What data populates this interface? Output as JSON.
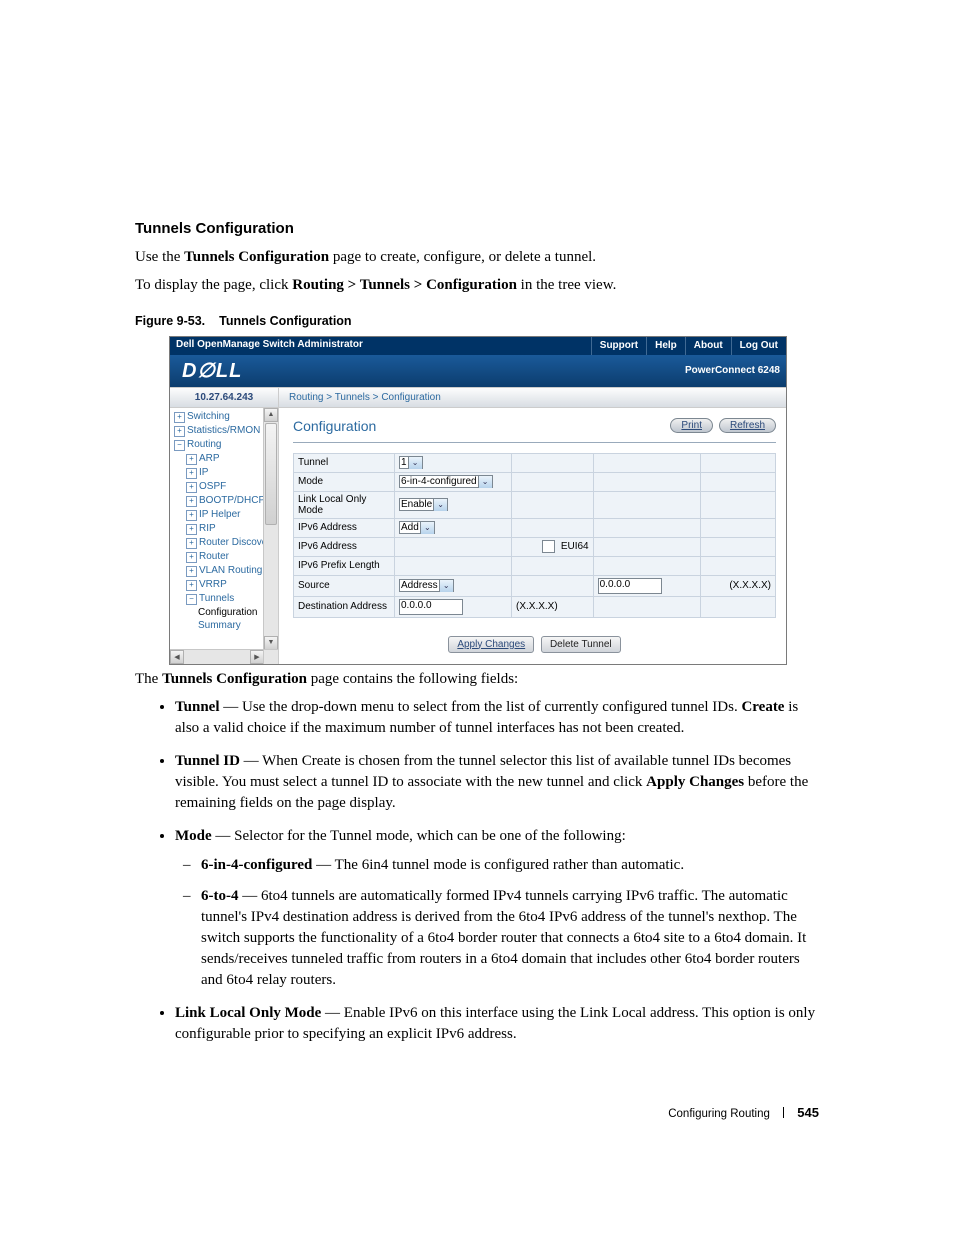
{
  "section": {
    "title": "Tunnels Configuration",
    "intro1_pre": "Use the ",
    "intro1_bold": "Tunnels Configuration",
    "intro1_post": " page to create, configure, or delete a tunnel.",
    "intro2_pre": "To display the page, click ",
    "intro2_bold": "Routing > Tunnels > Configuration",
    "intro2_post": " in the tree view."
  },
  "figure": {
    "label": "Figure 9-53.",
    "title": "Tunnels Configuration"
  },
  "shot": {
    "titlebar": {
      "title": "Dell OpenManage Switch Administrator",
      "nav": [
        "Support",
        "Help",
        "About",
        "Log Out"
      ]
    },
    "brand": {
      "logo": "D∅LL",
      "product": "PowerConnect 6248"
    },
    "ip": "10.27.64.243",
    "breadcrumb": [
      "Routing",
      "Tunnels",
      "Configuration"
    ],
    "tree": [
      {
        "label": "Switching",
        "tw": "+",
        "indent": 0
      },
      {
        "label": "Statistics/RMON",
        "tw": "+",
        "indent": 0
      },
      {
        "label": "Routing",
        "tw": "−",
        "indent": 0
      },
      {
        "label": "ARP",
        "tw": "+",
        "indent": 1
      },
      {
        "label": "IP",
        "tw": "+",
        "indent": 1
      },
      {
        "label": "OSPF",
        "tw": "+",
        "indent": 1
      },
      {
        "label": "BOOTP/DHCP Rela",
        "tw": "+",
        "indent": 1
      },
      {
        "label": "IP Helper",
        "tw": "+",
        "indent": 1
      },
      {
        "label": "RIP",
        "tw": "+",
        "indent": 1
      },
      {
        "label": "Router Discovery",
        "tw": "+",
        "indent": 1
      },
      {
        "label": "Router",
        "tw": "+",
        "indent": 1
      },
      {
        "label": "VLAN Routing",
        "tw": "+",
        "indent": 1
      },
      {
        "label": "VRRP",
        "tw": "+",
        "indent": 1
      },
      {
        "label": "Tunnels",
        "tw": "−",
        "indent": 1
      },
      {
        "label": "Configuration",
        "tw": "",
        "indent": 2,
        "active": true
      },
      {
        "label": "Summary",
        "tw": "",
        "indent": 2
      }
    ],
    "content": {
      "title": "Configuration",
      "buttons": {
        "print": "Print",
        "refresh": "Refresh"
      },
      "rows": {
        "tunnel_label": "Tunnel",
        "tunnel_value": "1",
        "mode_label": "Mode",
        "mode_value": "6-in-4-configured",
        "llom_label": "Link Local Only Mode",
        "llom_value": "Enable",
        "ipv6addr_label": "IPv6 Address",
        "ipv6addr_value": "Add",
        "ipv6addr2_label": "IPv6 Address",
        "eui64_label": "EUI64",
        "prefix_label": "IPv6 Prefix Length",
        "source_label": "Source",
        "source_sel": "Address",
        "source_val": "0.0.0.0",
        "source_hint": "(X.X.X.X)",
        "dest_label": "Destination Address",
        "dest_val": "0.0.0.0",
        "dest_hint": "(X.X.X.X)"
      },
      "actions": {
        "apply": "Apply Changes",
        "delete": "Delete Tunnel"
      }
    }
  },
  "after_figure": {
    "lead_pre": "The ",
    "lead_bold": "Tunnels Configuration",
    "lead_post": " page contains the following fields:"
  },
  "fields": {
    "tunnel": {
      "term": "Tunnel",
      "desc_a": " — Use the drop-down menu to select from the list of currently configured tunnel IDs. ",
      "bold": "Create",
      "desc_b": " is also a valid choice if the maximum number of tunnel interfaces has not been created."
    },
    "tunnel_id": {
      "term": "Tunnel ID",
      "desc_a": " — When Create is chosen from the tunnel selector this list of available tunnel IDs becomes visible. You must select a tunnel ID to associate with the new tunnel and click ",
      "bold": "Apply Changes",
      "desc_b": " before the remaining fields on the page display."
    },
    "mode": {
      "term": "Mode",
      "desc": " — Selector for the Tunnel mode, which can be one of the following:",
      "sub1_term": "6-in-4-configured",
      "sub1_desc": " — The 6in4 tunnel mode is configured rather than automatic.",
      "sub2_term": "6-to-4",
      "sub2_desc": " — 6to4 tunnels are automatically formed IPv4 tunnels carrying IPv6 traffic. The automatic tunnel's IPv4 destination address is derived from the 6to4 IPv6 address of the tunnel's nexthop. The switch supports the functionality of a 6to4 border router that connects a 6to4 site to a 6to4 domain. It sends/receives tunneled traffic from routers in a 6to4 domain that includes other 6to4 border routers and 6to4 relay routers."
    },
    "llom": {
      "term": "Link Local Only Mode",
      "desc": " — Enable IPv6 on this interface using the Link Local address. This option is only configurable prior to specifying an explicit IPv6 address."
    }
  },
  "footer": {
    "section": "Configuring Routing",
    "page": "545"
  }
}
